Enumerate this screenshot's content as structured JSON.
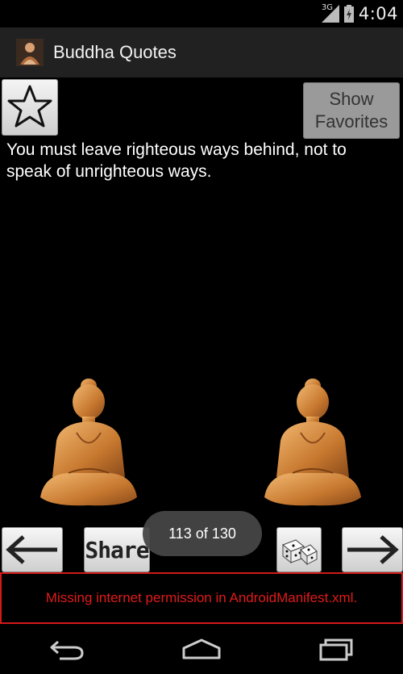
{
  "status": {
    "network": "3G",
    "time": "4:04"
  },
  "app": {
    "title": "Buddha Quotes"
  },
  "buttons": {
    "show_favorites_line1": "Show",
    "show_favorites_line2": "Favorites",
    "share": "Share"
  },
  "quote": {
    "text": "You must leave righteous ways behind, not to speak of unrighteous ways."
  },
  "toast": {
    "text": "113 of 130"
  },
  "ad": {
    "text": "Missing internet permission in AndroidManifest.xml."
  },
  "icons": {
    "favorite": "star-outline-icon",
    "prev": "arrow-left-icon",
    "next": "arrow-right-icon",
    "random": "dice-icon",
    "back": "back-icon",
    "home": "home-icon",
    "recents": "recents-icon"
  },
  "colors": {
    "ad_text": "#e21a1a",
    "actionbar": "#212121",
    "toast": "#464646"
  }
}
